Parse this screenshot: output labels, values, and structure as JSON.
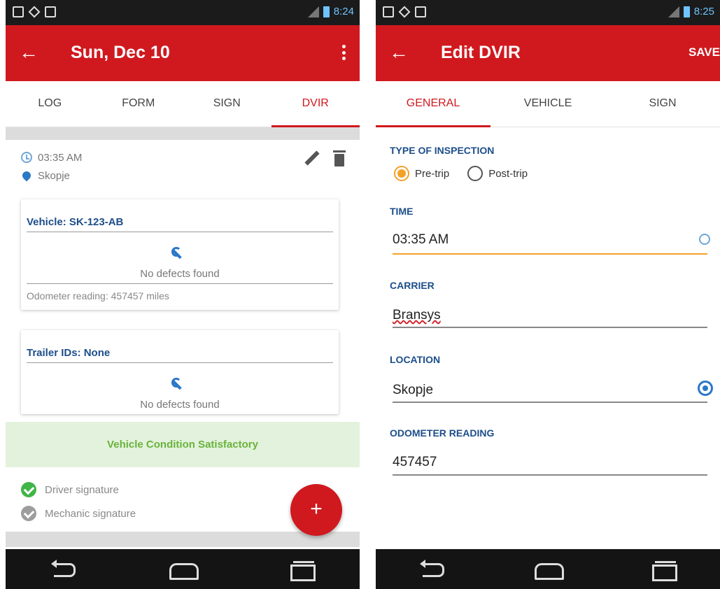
{
  "left": {
    "status_time": "8:24",
    "title": "Sun, Dec 10",
    "tabs": [
      "LOG",
      "FORM",
      "SIGN",
      "DVIR"
    ],
    "active_tab": "DVIR",
    "entry": {
      "time": "03:35 AM",
      "location": "Skopje"
    },
    "vehicle_card": {
      "title": "Vehicle: SK-123-AB",
      "status": "No defects found",
      "odometer": "Odometer reading: 457457 miles"
    },
    "trailer_card": {
      "title": "Trailer IDs: None",
      "status": "No defects found"
    },
    "condition": "Vehicle Condition Satisfactory",
    "signatures": [
      {
        "label": "Driver signature",
        "signed": true
      },
      {
        "label": "Mechanic signature",
        "signed": false
      }
    ],
    "fab_label": "+"
  },
  "right": {
    "status_time": "8:25",
    "title": "Edit DVIR",
    "save_label": "SAVE",
    "tabs": [
      "GENERAL",
      "VEHICLE",
      "SIGN"
    ],
    "active_tab": "GENERAL",
    "type_label": "TYPE OF INSPECTION",
    "inspection_options": [
      "Pre-trip",
      "Post-trip"
    ],
    "selected_option": "Pre-trip",
    "time_label": "TIME",
    "time_value": "03:35 AM",
    "carrier_label": "CARRIER",
    "carrier_value": "Bransys",
    "location_label": "LOCATION",
    "location_value": "Skopje",
    "odometer_label": "ODOMETER READING",
    "odometer_value": "457457"
  },
  "colors": {
    "brand_red": "#d0191f",
    "label_blue": "#1c4e8a",
    "success_green": "#41b54a",
    "focus_orange": "#f4a12a"
  },
  "icons": [
    "back-arrow-icon",
    "more-vert-icon",
    "clock-icon",
    "pin-icon",
    "edit-icon",
    "trash-icon",
    "wrench-icon",
    "check-circle-icon",
    "my-location-icon",
    "nav-back-icon",
    "nav-home-icon",
    "nav-recent-icon"
  ]
}
